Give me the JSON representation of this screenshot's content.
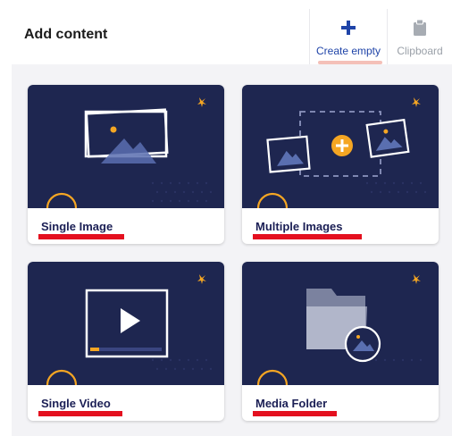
{
  "header": {
    "title": "Add content",
    "create_empty_label": "Create empty",
    "clipboard_label": "Clipboard"
  },
  "cards": [
    {
      "label": "Single Image",
      "icon": "image-icon"
    },
    {
      "label": "Multiple Images",
      "icon": "multiple-images-icon"
    },
    {
      "label": "Single Video",
      "icon": "video-icon"
    },
    {
      "label": "Media Folder",
      "icon": "folder-icon"
    }
  ],
  "colors": {
    "card_art_background": "#1e2650",
    "accent_orange": "#f5a623",
    "brand_blue": "#1f44a8",
    "highlight_red": "#e4101f"
  }
}
